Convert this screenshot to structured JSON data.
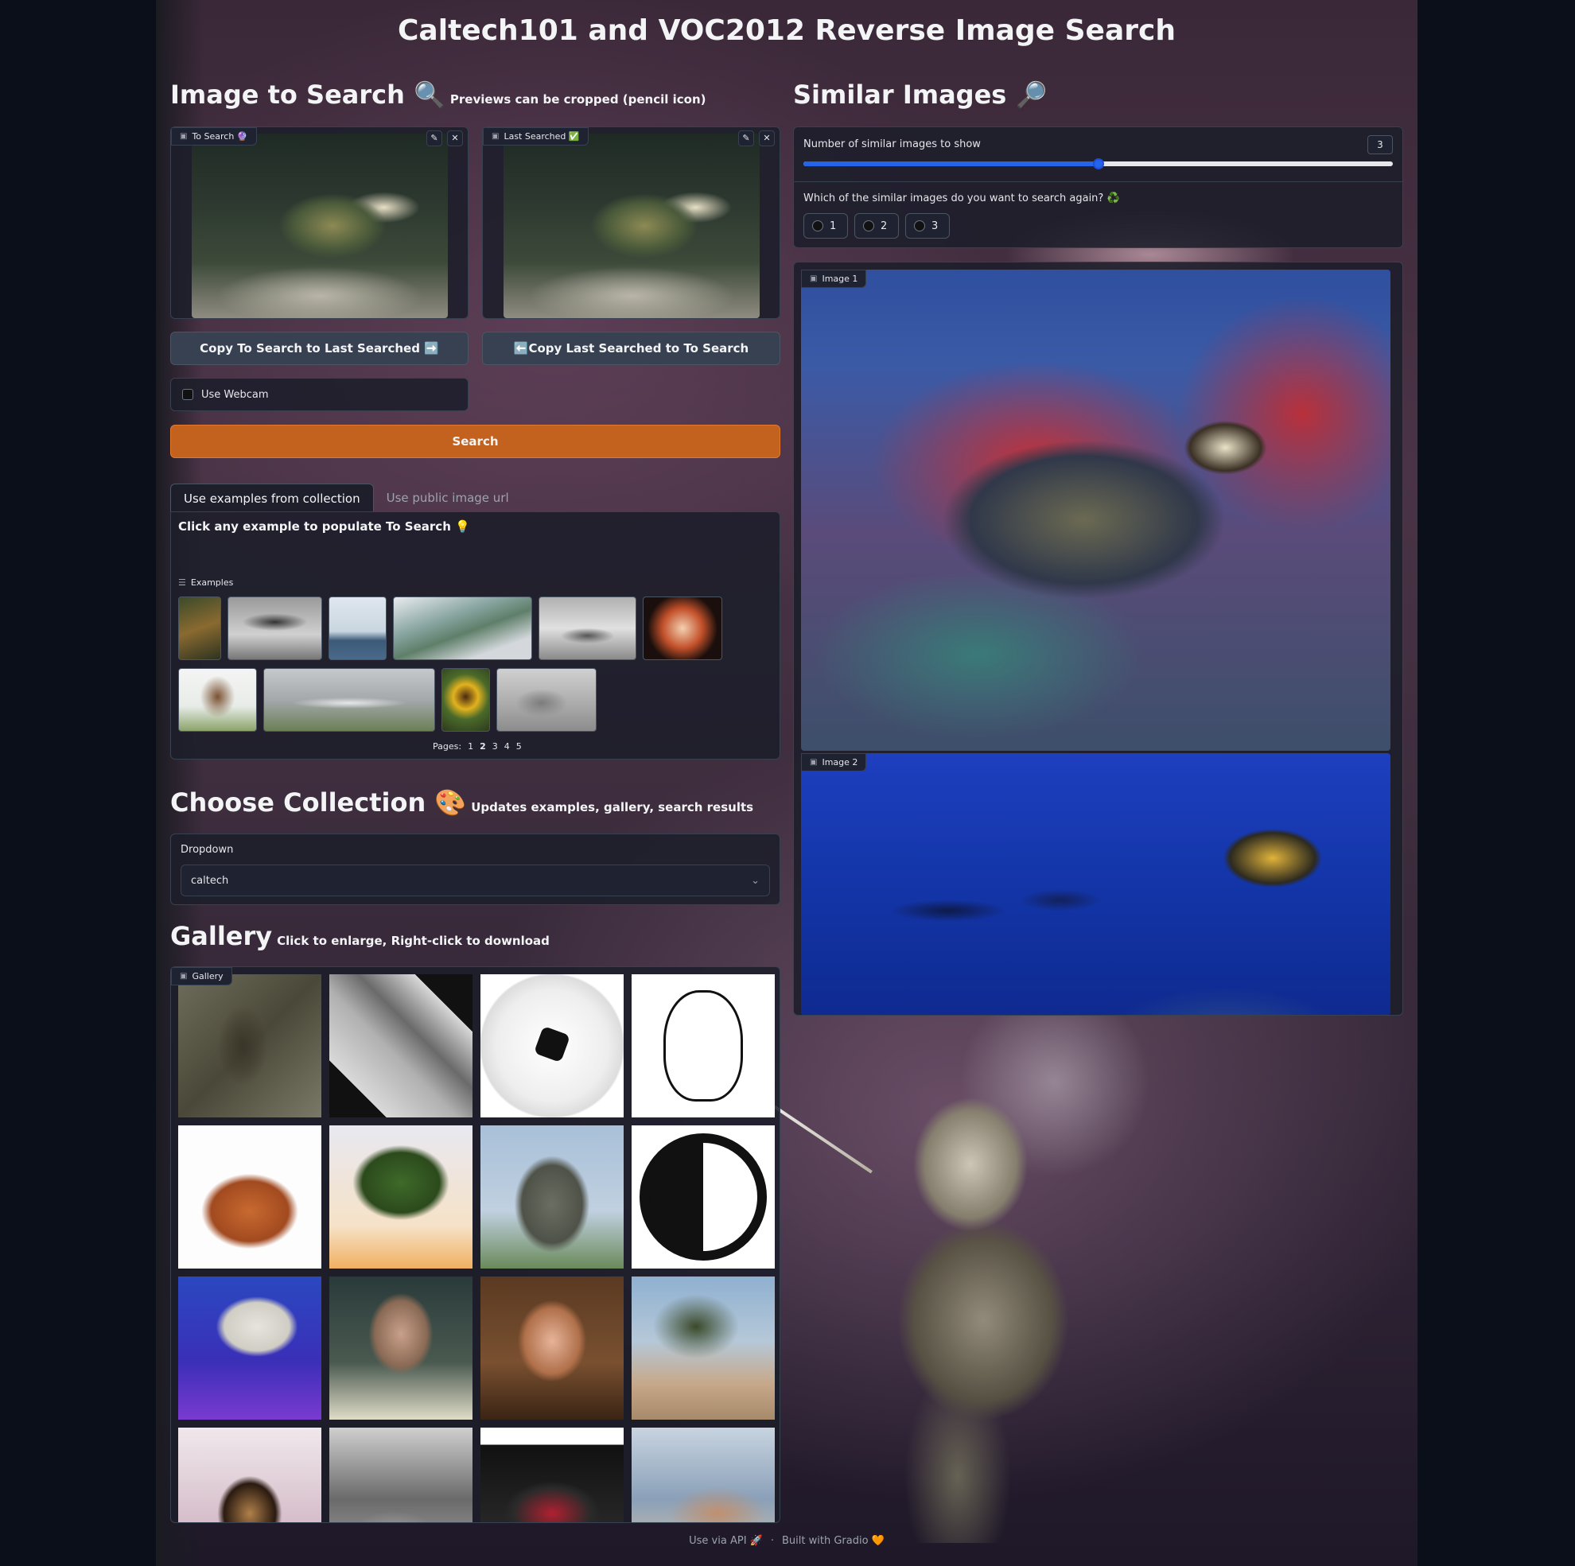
{
  "page": {
    "title": "Caltech101 and VOC2012 Reverse Image Search"
  },
  "search_section": {
    "heading": "Image to Search 🔍",
    "hint": "Previews can be cropped (pencil icon)",
    "to_search_label": "To Search 🔮",
    "last_searched_label": "Last Searched ✅",
    "copy_to_last_label": "Copy To Search to Last Searched ➡️",
    "copy_to_search_label": "⬅️Copy Last Searched to To Search",
    "webcam_label": "Use Webcam",
    "search_button_label": "Search"
  },
  "examples_section": {
    "tabs": [
      {
        "label": "Use examples from collection",
        "active": true
      },
      {
        "label": "Use public image url",
        "active": false
      }
    ],
    "instruction": "Click any example to populate To Search 💡",
    "examples_label": "Examples",
    "pages_label": "Pages:",
    "pages": [
      "1",
      "2",
      "3",
      "4",
      "5"
    ]
  },
  "collection_section": {
    "heading": "Choose Collection 🎨",
    "hint": "Updates examples, gallery, search results",
    "dropdown_label": "Dropdown",
    "dropdown_value": "caltech"
  },
  "gallery_section": {
    "heading": "Gallery",
    "hint": "Click to enlarge, Right-click to download",
    "gallery_label": "Gallery"
  },
  "similar_section": {
    "heading": "Similar Images 🔎",
    "slider_label": "Number of similar images to show",
    "slider_value": "3",
    "slider_fraction": 0.5,
    "radio_label": "Which of the similar images do you want to search again? ♻️",
    "radio_options": [
      "1",
      "2",
      "3"
    ],
    "image1_label": "Image 1",
    "image2_label": "Image 2"
  },
  "footer": {
    "api_label": "Use via API 🚀",
    "separator": "·",
    "built_label": "Built with Gradio 🧡"
  },
  "colors": {
    "accent": "#c2621e",
    "slider": "#2563eb",
    "panel": "#1c1e2a"
  }
}
